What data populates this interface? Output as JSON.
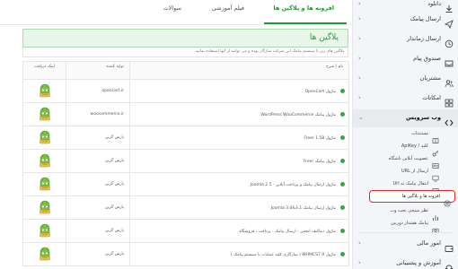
{
  "tabs": [
    {
      "label": "افزونه ها و پلاگین ها",
      "active": true
    },
    {
      "label": "فیلم آموزشی",
      "active": false
    },
    {
      "label": "سوالات",
      "active": false
    }
  ],
  "banner": {
    "title": "پلاگین ها",
    "notice": "پلاگین های زیر با سیستم پیامک این شرکت سازگار بوده و می توانید از آنها استفاده نمایید."
  },
  "table": {
    "headers": {
      "title": "نام / شرح",
      "supplier": "تولید کننده",
      "link": "لینک دریافت"
    },
    "rows": [
      {
        "title": "ماژول OpenCart",
        "supplier": "opencart.ir"
      },
      {
        "title": "ماژول پیامک WordPress WooCommerce",
        "supplier": "woocommerce.ir"
      },
      {
        "title": "ماژول Freer 1.58",
        "supplier": "پارس گرین"
      },
      {
        "title": "ماژول پیامک Freer",
        "supplier": "پارس گرین"
      },
      {
        "title": "ماژول ارسال پیامک و پرداخت آنلاین - Joomla 2.5",
        "supplier": "پارس گرین"
      },
      {
        "title": "ماژول ارسال پیامک Joomla 3.0&3.1",
        "supplier": "پارس گرین"
      },
      {
        "title": "ماژول دیتاکیف انجمن - ارسال پیامک ، پرداخت ، فروشگاه",
        "supplier": "پارس گرین"
      },
      {
        "title": "ماژول WHMCS7.9 ( سازگاری کلیه عملیات با سیستم پیامک )",
        "supplier": "پارس گرین"
      }
    ]
  },
  "sidebar": {
    "top_items": [
      {
        "label": "دانلود",
        "icon": "download-icon"
      },
      {
        "label": "ارسال پیامک",
        "icon": "send-icon"
      },
      {
        "label": "ارسال زماندار",
        "icon": "clock-icon"
      },
      {
        "label": "صندوق پیام",
        "icon": "inbox-icon"
      },
      {
        "label": "مشتریان",
        "icon": "users-icon"
      },
      {
        "label": "امکانات",
        "icon": "apps-icon"
      }
    ],
    "open_item": {
      "label": "وب سرویس",
      "icon": "code-icon"
    },
    "sub_items": [
      {
        "label": "مستندات",
        "icon": "book-icon"
      },
      {
        "label": "کلید / ApiKey",
        "icon": "key-icon"
      },
      {
        "label": "عضویت آنلاین باشگاه",
        "icon": "id-card-icon"
      },
      {
        "label": "ارسال از URL",
        "icon": "link-icon"
      },
      {
        "label": "انتقال پیامک به Url",
        "icon": "transfer-icon"
      },
      {
        "label": "افزونه ها و پلاگین ها",
        "icon": "plugin-icon",
        "active": true
      },
      {
        "label": "نظر سنجی تحت وب",
        "icon": "poll-icon"
      },
      {
        "label": "پیامک هشدار دوربین",
        "icon": "camera-icon"
      }
    ],
    "bottom_items": [
      {
        "label": "امور مالی",
        "icon": "wallet-icon"
      },
      {
        "label": "آموزش و پشتیبانی",
        "icon": "support-icon"
      }
    ]
  },
  "colors": {
    "accent": "#23963a",
    "highlight_border": "#e02828",
    "robot": "#7cc242"
  }
}
